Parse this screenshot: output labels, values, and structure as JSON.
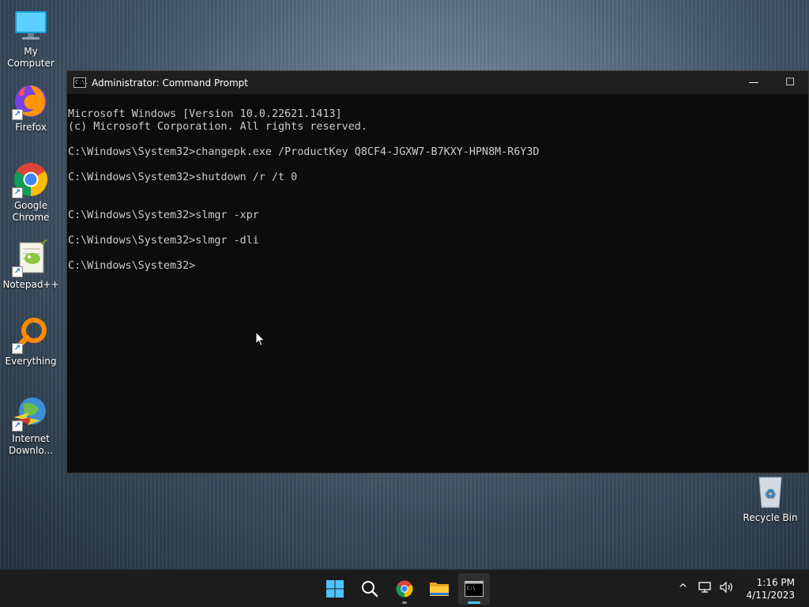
{
  "desktop": {
    "icons": [
      {
        "label": "My Computer"
      },
      {
        "label": "Firefox"
      },
      {
        "label": "Google Chrome"
      },
      {
        "label": "Notepad++"
      },
      {
        "label": "Everything"
      },
      {
        "label": "Internet Downlo..."
      },
      {
        "label": "Recycle Bin"
      }
    ]
  },
  "window": {
    "title": "Administrator: Command Prompt",
    "icon_text": "C:\\.",
    "minimize_glyph": "—",
    "maximize_glyph": "☐",
    "console_lines": [
      "Microsoft Windows [Version 10.0.22621.1413]",
      "(c) Microsoft Corporation. All rights reserved.",
      "",
      "C:\\Windows\\System32>changepk.exe /ProductKey Q8CF4-JGXW7-B7KXY-HPN8M-R6Y3D",
      "",
      "C:\\Windows\\System32>shutdown /r /t 0",
      "",
      "",
      "C:\\Windows\\System32>slmgr -xpr",
      "",
      "C:\\Windows\\System32>slmgr -dli",
      "",
      "C:\\Windows\\System32>"
    ]
  },
  "taskbar": {
    "apps": [
      "start",
      "search",
      "chrome",
      "file-explorer",
      "command-prompt"
    ],
    "tray": {
      "chevron": "^",
      "time": "1:16 PM",
      "date": "4/11/2023"
    }
  },
  "colors": {
    "console_bg": "#0c0c0c",
    "console_text": "#cccccc",
    "titlebar_bg": "#1f1f1f",
    "taskbar_bg": "#1c1c1c",
    "accent": "#4cc2ff"
  }
}
